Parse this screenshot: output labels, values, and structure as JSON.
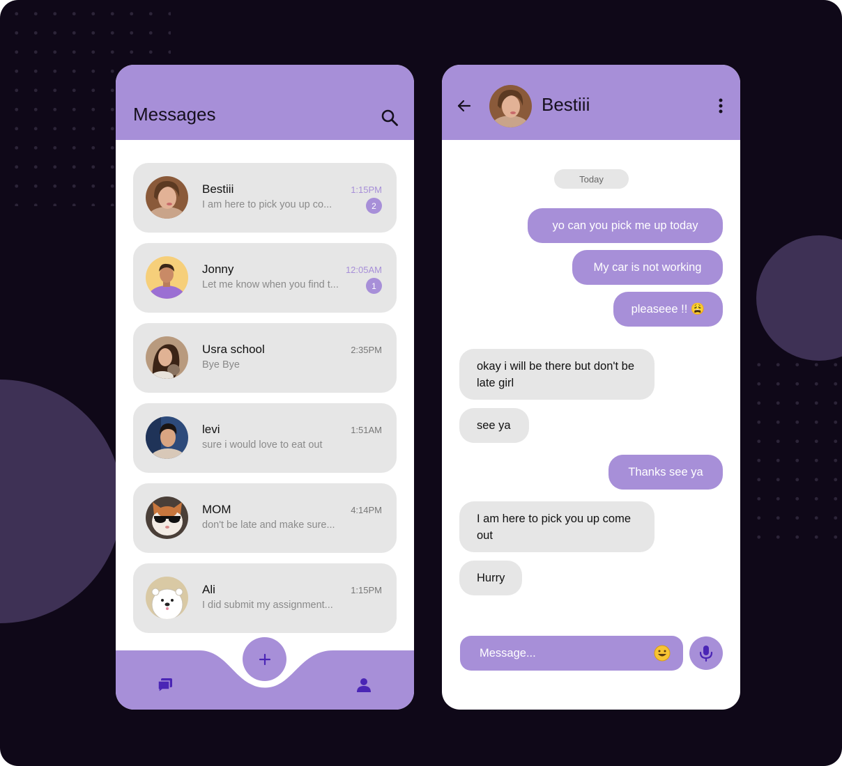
{
  "colors": {
    "accent": "#a78fd8",
    "background": "#0f0818",
    "bubble_incoming": "#e6e6e6",
    "icon_dark": "#4a25b5"
  },
  "list_screen": {
    "title": "Messages",
    "search_icon": "search-icon",
    "contacts": [
      {
        "name": "Bestiii",
        "preview": "I am here to pick you up co...",
        "time": "1:15PM",
        "unread": "2",
        "avatar": "woman-portrait"
      },
      {
        "name": "Jonny",
        "preview": "Let me know when you find t...",
        "time": "12:05AM",
        "unread": "1",
        "avatar": "man-purple-shirt"
      },
      {
        "name": "Usra school",
        "preview": "Bye Bye",
        "time": "2:35PM",
        "avatar": "woman-with-cat"
      },
      {
        "name": "levi",
        "preview": "sure i would love to eat out",
        "time": "1:51AM",
        "avatar": "man-portrait"
      },
      {
        "name": "MOM",
        "preview": "don't be late and make sure...",
        "time": "4:14PM",
        "avatar": "cat-with-sunglasses"
      },
      {
        "name": "Ali",
        "preview": "I did submit my assignment...",
        "time": "1:15PM",
        "avatar": "cartoon-polar-bear"
      }
    ],
    "bottom_nav": {
      "fab": "plus-icon",
      "left": "chat-icon",
      "right": "profile-icon"
    }
  },
  "chat_screen": {
    "contact_name": "Bestiii",
    "date_divider": "Today",
    "messages": [
      {
        "from": "me",
        "text": "yo can you pick me up today"
      },
      {
        "from": "me",
        "text": "My car is not working"
      },
      {
        "from": "me",
        "text": "pleaseee !! 😩"
      },
      {
        "from": "them",
        "text": "okay i will be there but don't be late girl"
      },
      {
        "from": "them",
        "text": "see ya"
      },
      {
        "from": "me",
        "text": "Thanks see ya"
      },
      {
        "from": "them",
        "text": "I am here to pick you up come out"
      },
      {
        "from": "them",
        "text": "Hurry"
      }
    ],
    "composer": {
      "placeholder": "Message...",
      "emoji_icon": "smiley-icon",
      "mic_icon": "microphone-icon"
    }
  }
}
